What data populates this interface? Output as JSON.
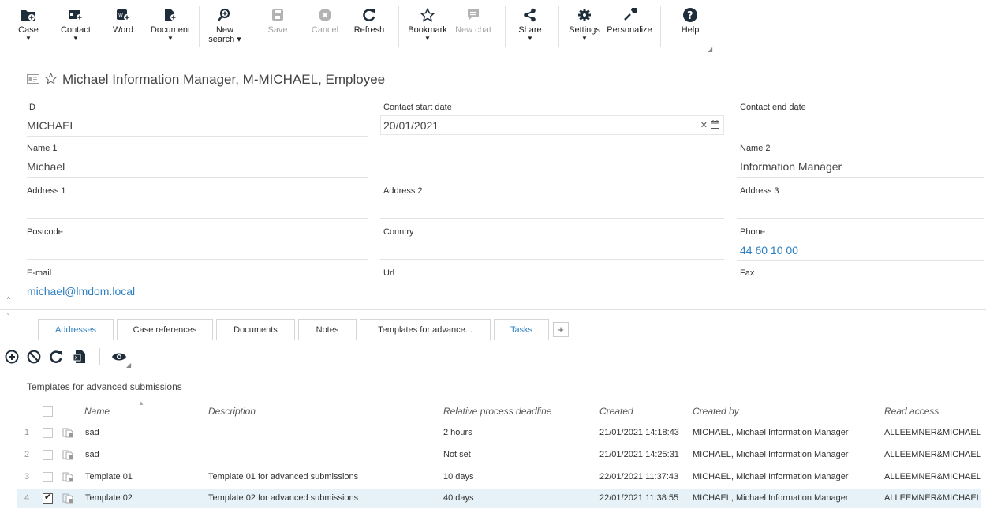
{
  "toolbar": {
    "case": "Case",
    "contact": "Contact",
    "word": "Word",
    "document": "Document",
    "new_search_1": "New",
    "new_search_2": "search ▾",
    "save": "Save",
    "cancel": "Cancel",
    "refresh": "Refresh",
    "bookmark": "Bookmark",
    "new_chat": "New chat",
    "share": "Share",
    "settings": "Settings",
    "personalize": "Personalize",
    "help": "Help"
  },
  "record": {
    "title": "Michael Information Manager, M-MICHAEL, Employee",
    "fields": {
      "id_label": "ID",
      "id_value": "MICHAEL",
      "start_label": "Contact start date",
      "start_value": "20/01/2021",
      "end_label": "Contact end date",
      "end_value": "",
      "name1_label": "Name 1",
      "name1_value": "Michael",
      "name2_label": "Name 2",
      "name2_value": "Information Manager",
      "addr1_label": "Address 1",
      "addr2_label": "Address 2",
      "addr3_label": "Address 3",
      "postcode_label": "Postcode",
      "country_label": "Country",
      "phone_label": "Phone",
      "phone_value": "44 60 10 00",
      "email_label": "E-mail",
      "email_value": "michael@lmdom.local",
      "url_label": "Url",
      "fax_label": "Fax"
    }
  },
  "tabs": [
    {
      "label": "Addresses"
    },
    {
      "label": "Case references"
    },
    {
      "label": "Documents"
    },
    {
      "label": "Notes"
    },
    {
      "label": "Templates for advance..."
    },
    {
      "label": "Tasks"
    },
    {
      "label": "+"
    }
  ],
  "grid": {
    "title": "Templates for advanced submissions",
    "columns": [
      "Name",
      "Description",
      "Relative process deadline",
      "Created",
      "Created by",
      "Read access"
    ],
    "rows": [
      {
        "num": "1",
        "name": "sad",
        "description": "",
        "deadline": "2 hours",
        "created": "21/01/2021 14:18:43",
        "created_by": "MICHAEL, Michael Information Manager",
        "read_access": "ALLEEMNER&MICHAEL",
        "checked": false
      },
      {
        "num": "2",
        "name": "sad",
        "description": "",
        "deadline": "Not set",
        "created": "21/01/2021 14:25:31",
        "created_by": "MICHAEL, Michael Information Manager",
        "read_access": "ALLEEMNER&MICHAEL",
        "checked": false
      },
      {
        "num": "3",
        "name": "Template 01",
        "description": "Template 01 for advanced submissions",
        "deadline": "10 days",
        "created": "22/01/2021 11:37:43",
        "created_by": "MICHAEL, Michael Information Manager",
        "read_access": "ALLEEMNER&MICHAEL",
        "checked": false
      },
      {
        "num": "4",
        "name": "Template 02",
        "description": "Template 02 for advanced submissions",
        "deadline": "40 days",
        "created": "22/01/2021 11:38:55",
        "created_by": "MICHAEL, Michael Information Manager",
        "read_access": "ALLEEMNER&MICHAEL",
        "checked": true
      }
    ]
  },
  "colors": {
    "link": "#2d7fc1",
    "selected_row": "#e6f2f8",
    "icon_dark": "#1f2d3a",
    "icon_disabled": "#b3b3b3"
  }
}
